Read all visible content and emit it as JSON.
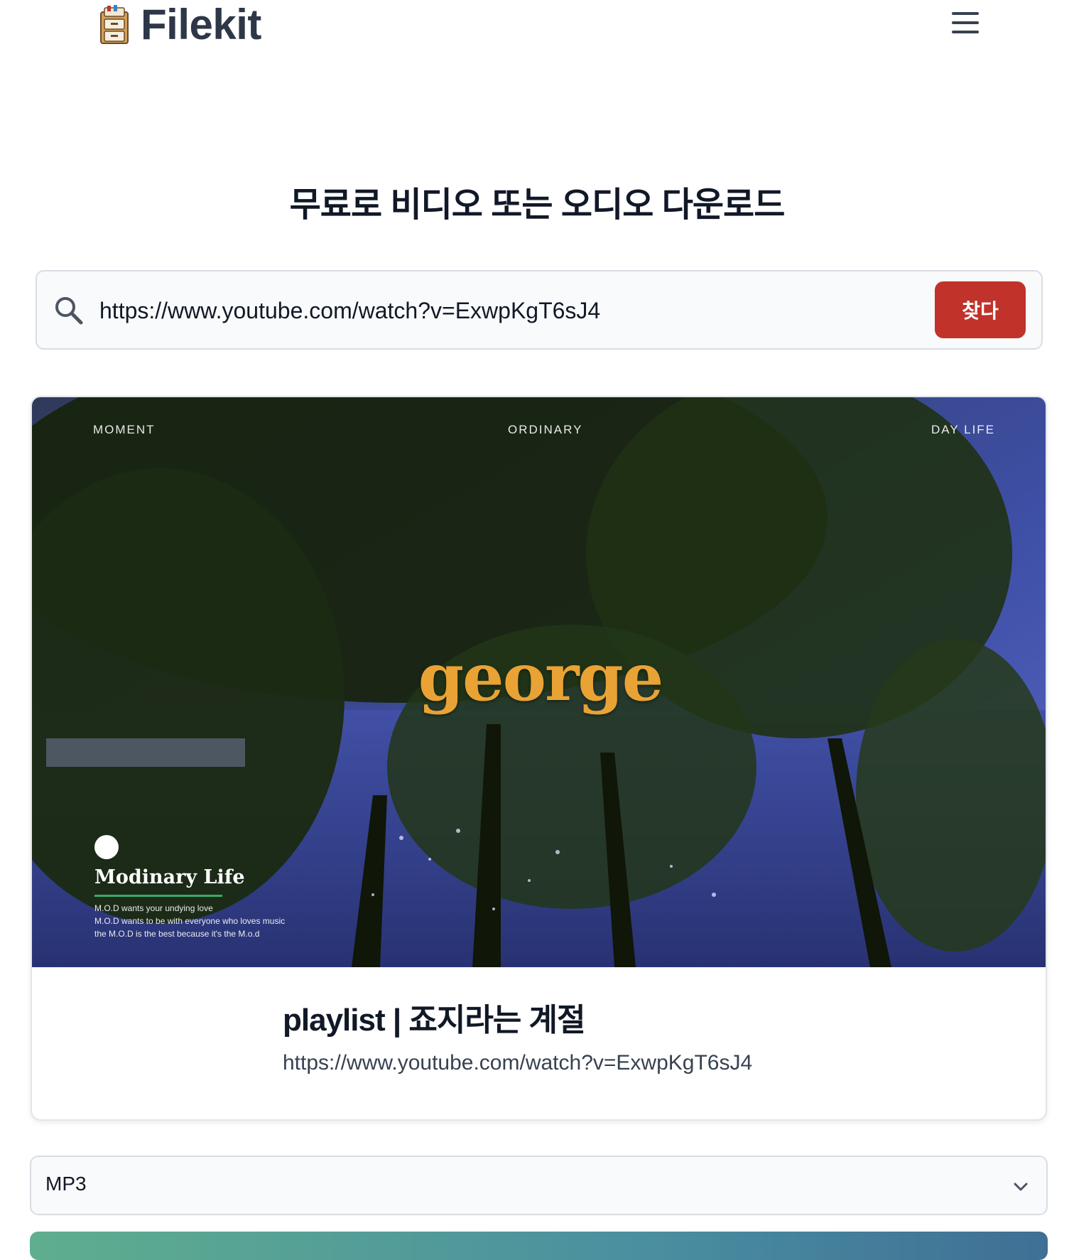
{
  "header": {
    "brand": "Filekit",
    "logo_icon": "file-cabinet-icon",
    "menu_icon": "hamburger-menu-icon"
  },
  "main": {
    "title": "무료로 비디오 또는 오디오 다운로드"
  },
  "search": {
    "icon": "search-icon",
    "value": "https://www.youtube.com/watch?v=ExwpKgT6sJ4",
    "button_label": "찾다",
    "button_color": "#c0322a"
  },
  "video": {
    "thumbnail": {
      "top_left": "MOMENT",
      "top_center": "ORDINARY",
      "top_right": "DAY LIFE",
      "center_text": "george",
      "brand_name": "Modinary Life",
      "brand_lines": [
        "M.O.D wants your undying love",
        "M.O.D wants to be with everyone who loves music",
        "the M.O.D is the best because it's the M.o.d"
      ],
      "center_text_color": "#e9a334"
    },
    "title": "playlist | 죠지라는 계절",
    "url": "https://www.youtube.com/watch?v=ExwpKgT6sJ4"
  },
  "format": {
    "selected": "MP3",
    "icon": "chevron-down-icon"
  },
  "colors": {
    "accent_red": "#c0322a",
    "download_gradient_start": "#5fae8e",
    "download_gradient_end": "#3f6f95"
  }
}
